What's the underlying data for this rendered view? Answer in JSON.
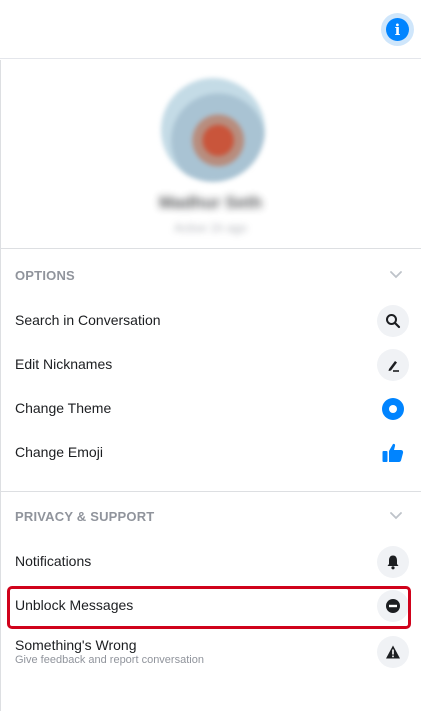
{
  "header": {
    "info_icon": "info-icon",
    "accent": "#0084ff"
  },
  "profile": {
    "name": "Madhur Seth",
    "subtitle": "Active 1h ago"
  },
  "options": {
    "title": "OPTIONS",
    "items": [
      {
        "label": "Search in Conversation",
        "icon": "search-icon"
      },
      {
        "label": "Edit Nicknames",
        "icon": "pencil-icon"
      },
      {
        "label": "Change Theme",
        "icon": "theme-icon"
      },
      {
        "label": "Change Emoji",
        "icon": "thumbs-up-icon"
      }
    ]
  },
  "privacy": {
    "title": "PRIVACY & SUPPORT",
    "items": [
      {
        "label": "Notifications",
        "icon": "bell-icon"
      },
      {
        "label": "Unblock Messages",
        "icon": "minus-circle-icon"
      },
      {
        "label": "Something's Wrong",
        "sublabel": "Give feedback and report conversation",
        "icon": "warning-icon"
      }
    ]
  },
  "highlight_color": "#d0021b"
}
